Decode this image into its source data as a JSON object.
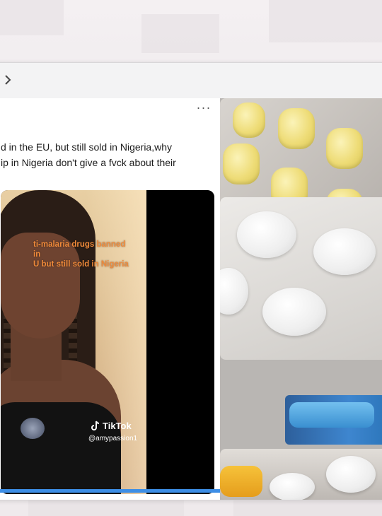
{
  "post": {
    "text": "d in the EU, but still sold in Nigeria,why\nip in Nigeria don't give a fvck about their",
    "more_label": "···"
  },
  "video": {
    "caption": "ti-malaria drugs banned in\nU but still sold in Nigeria",
    "brand": "TikTok",
    "handle": "@amypassion1"
  },
  "colors": {
    "caption": "#f08a3a",
    "progress": "#3d8ee6",
    "toolbar": "#f3f3f4"
  },
  "icons": {
    "back": "chevron-right-icon",
    "more": "more-horizontal-icon",
    "tiktok": "tiktok-logo-icon"
  }
}
